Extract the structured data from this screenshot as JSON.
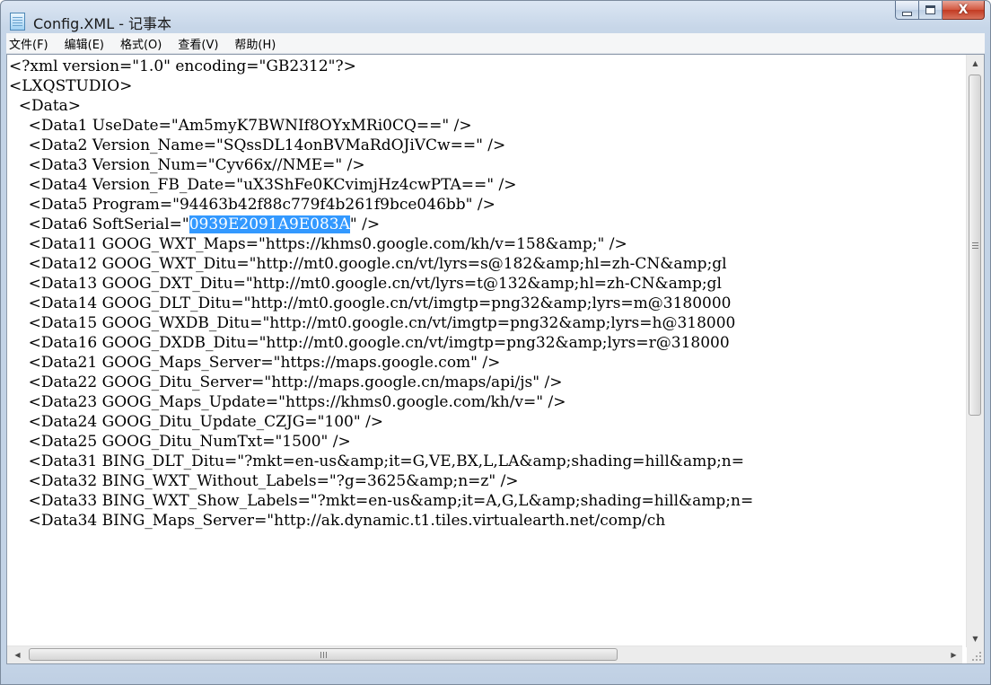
{
  "window": {
    "title": "Config.XML - 记事本"
  },
  "caption": {
    "close_glyph": "X"
  },
  "menu": [
    {
      "label": "文件(F)"
    },
    {
      "label": "编辑(E)"
    },
    {
      "label": "格式(O)"
    },
    {
      "label": "查看(V)"
    },
    {
      "label": "帮助(H)"
    }
  ],
  "editor": {
    "lines": [
      {
        "text": "<?xml version=\"1.0\" encoding=\"GB2312\"?>"
      },
      {
        "text": "<LXQSTUDIO>"
      },
      {
        "text": "  <Data>"
      },
      {
        "text": "    <Data1 UseDate=\"Am5myK7BWNIf8OYxMRi0CQ==\" />"
      },
      {
        "text": "    <Data2 Version_Name=\"SQssDL14onBVMaRdOJiVCw==\" />"
      },
      {
        "text": "    <Data3 Version_Num=\"Cyv66x//NME=\" />"
      },
      {
        "text": "    <Data4 Version_FB_Date=\"uX3ShFe0KCvimjHz4cwPTA==\" />"
      },
      {
        "text": "    <Data5 Program=\"94463b42f88c779f4b261f9bce046bb\" />"
      },
      {
        "pre": "    <Data6 SoftSerial=\"",
        "selected": "0939E2091A9E083A",
        "post": "\" />"
      },
      {
        "text": "    <Data11 GOOG_WXT_Maps=\"https://khms0.google.com/kh/v=158&amp;\" />"
      },
      {
        "text": "    <Data12 GOOG_WXT_Ditu=\"http://mt0.google.cn/vt/lyrs=s@182&amp;hl=zh-CN&amp;gl"
      },
      {
        "text": "    <Data13 GOOG_DXT_Ditu=\"http://mt0.google.cn/vt/lyrs=t@132&amp;hl=zh-CN&amp;gl"
      },
      {
        "text": "    <Data14 GOOG_DLT_Ditu=\"http://mt0.google.cn/vt/imgtp=png32&amp;lyrs=m@3180000"
      },
      {
        "text": "    <Data15 GOOG_WXDB_Ditu=\"http://mt0.google.cn/vt/imgtp=png32&amp;lyrs=h@318000"
      },
      {
        "text": "    <Data16 GOOG_DXDB_Ditu=\"http://mt0.google.cn/vt/imgtp=png32&amp;lyrs=r@318000"
      },
      {
        "text": "    <Data21 GOOG_Maps_Server=\"https://maps.google.com\" />"
      },
      {
        "text": "    <Data22 GOOG_Ditu_Server=\"http://maps.google.cn/maps/api/js\" />"
      },
      {
        "text": "    <Data23 GOOG_Maps_Update=\"https://khms0.google.com/kh/v=\" />"
      },
      {
        "text": "    <Data24 GOOG_Ditu_Update_CZJG=\"100\" />"
      },
      {
        "text": "    <Data25 GOOG_Ditu_NumTxt=\"1500\" />"
      },
      {
        "text": "    <Data31 BING_DLT_Ditu=\"?mkt=en-us&amp;it=G,VE,BX,L,LA&amp;shading=hill&amp;n="
      },
      {
        "text": "    <Data32 BING_WXT_Without_Labels=\"?g=3625&amp;n=z\" />"
      },
      {
        "text": "    <Data33 BING_WXT_Show_Labels=\"?mkt=en-us&amp;it=A,G,L&amp;shading=hill&amp;n="
      },
      {
        "text": "    <Data34 BING_Maps_Server=\"http://ak.dynamic.t1.tiles.virtualearth.net/comp/ch"
      }
    ]
  },
  "scrollbars": {
    "up_glyph": "▲",
    "down_glyph": "▼",
    "left_glyph": "◀",
    "right_glyph": "▶"
  }
}
